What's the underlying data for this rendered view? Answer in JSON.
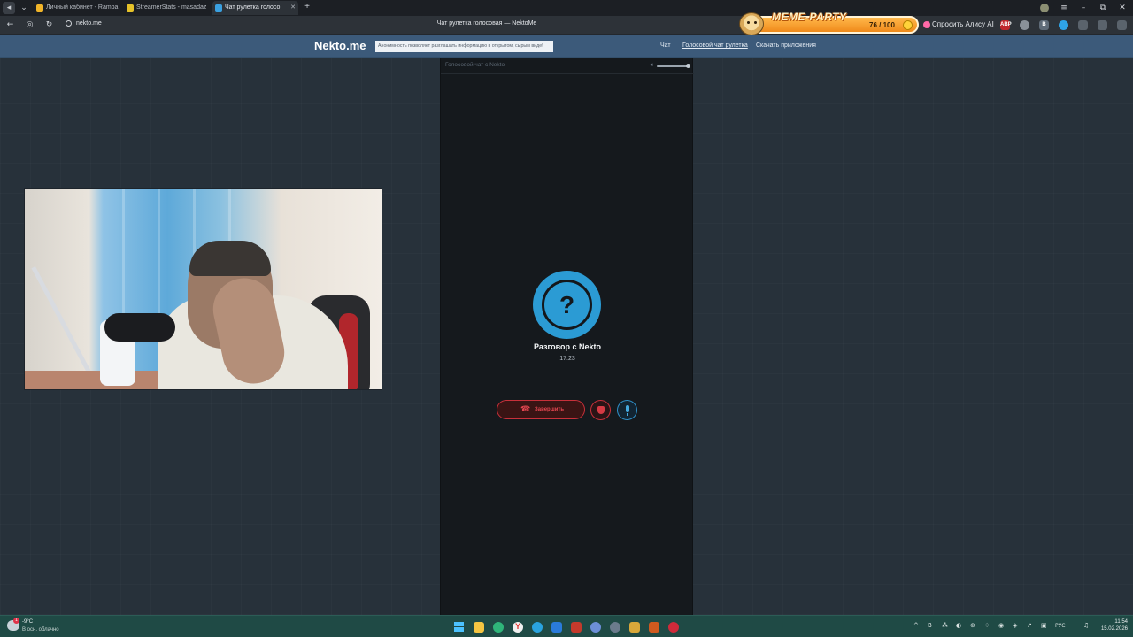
{
  "browser": {
    "tabs": [
      {
        "label": "Личный кабинет - Rampa",
        "fav_color": "#f0b429"
      },
      {
        "label": "StreamerStats - masadaz",
        "fav_color": "#e6c229"
      },
      {
        "label": "Чат рулетка голосо",
        "fav_color": "#3aa0e0",
        "active": true
      }
    ],
    "url": "nekto.me",
    "page_title": "Чат рулетка голосовая — NektoMe",
    "close_glyph": "✕",
    "new_tab_glyph": "+",
    "window_controls": [
      "≡",
      "–",
      "⧉",
      "✕"
    ],
    "nav": {
      "back": "←",
      "forward": "◎",
      "reload": "↻"
    }
  },
  "extensions": {
    "meme_party": {
      "title": "MEME-PARTY",
      "count": "76 / 100"
    },
    "alisa_label": "Спросить Алису AI",
    "icons": [
      {
        "name": "adblock-icon",
        "label": "ABP",
        "color": "#c0262d"
      },
      {
        "name": "extension-icon",
        "label": "",
        "color": "#8a9199"
      },
      {
        "name": "bookmark-icon",
        "label": "B",
        "color": "#5f6b78"
      },
      {
        "name": "sync-icon",
        "label": "",
        "color": "#2fa4e7"
      },
      {
        "name": "puzzle-icon",
        "label": "",
        "color": "#5a636c"
      },
      {
        "name": "download-icon",
        "label": "",
        "color": "#5a636c"
      },
      {
        "name": "menu-icon",
        "label": "",
        "color": "#5a636c"
      }
    ]
  },
  "site": {
    "logo": "Nekto.me",
    "notice": "Анонимность позволяет разглашать информацию в открытом, сырым виде!",
    "nav": [
      {
        "label": "Чат"
      },
      {
        "label": "Голосовой чат рулетка",
        "current": true
      },
      {
        "label": "Скачать приложения"
      }
    ]
  },
  "voice_chat": {
    "panel_title": "Голосовой чат с Nekto",
    "avatar_glyph": "?",
    "conversation_title": "Разговор с Nekto",
    "timer": "17:23",
    "end_button_label": "Завершить",
    "volume_level": 1.0,
    "colors": {
      "accent": "#2b9bd4",
      "danger": "#c8303a"
    }
  },
  "taskbar": {
    "weather": {
      "temp": "-9°C",
      "desc": "В осн. облачно",
      "badge": "1"
    },
    "apps": [
      {
        "name": "start-button-icon",
        "color": "#4cc2ff"
      },
      {
        "name": "file-explorer-icon",
        "color": "#f5c542"
      },
      {
        "name": "edge-browser-icon",
        "color": "#2fb57a"
      },
      {
        "name": "chrome-browser-icon",
        "color": "#e5e5e5"
      },
      {
        "name": "yandex-browser-icon",
        "color": "#f0f0f0"
      },
      {
        "name": "telegram-icon",
        "color": "#2aa3df"
      },
      {
        "name": "app-blue-icon",
        "color": "#2a7bdb"
      },
      {
        "name": "app-red-icon",
        "color": "#c43a2c"
      },
      {
        "name": "app-gem-icon",
        "color": "#6d8fd8"
      },
      {
        "name": "steam-icon",
        "color": "#6b7b8c"
      },
      {
        "name": "obs-icon",
        "color": "#d9a83a"
      },
      {
        "name": "app-fox-icon",
        "color": "#d05a1f"
      },
      {
        "name": "app-record-icon",
        "color": "#d02a3a"
      }
    ],
    "tray": [
      "^",
      "В",
      "⁂",
      "◐",
      "⊕",
      "♢",
      "◉",
      "◈",
      "↗",
      "▣",
      "♫"
    ],
    "lang": "РУС",
    "time": "11:54",
    "date": "15.02.2026"
  }
}
